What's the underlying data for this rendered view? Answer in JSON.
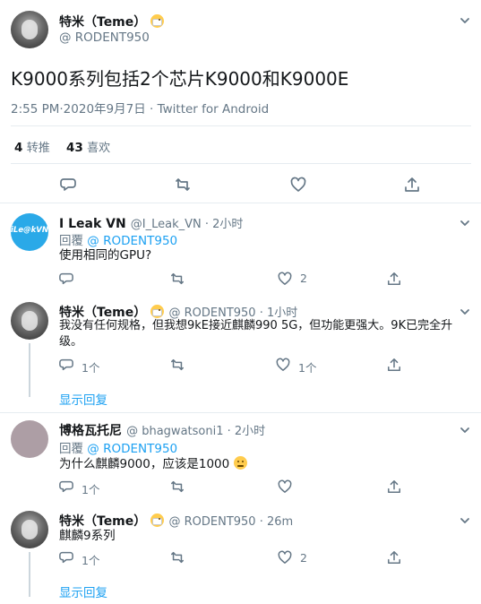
{
  "main_tweet": {
    "author_name": "特米（Teme）",
    "author_handle": "@ RODENT950",
    "text": "K9000系列包括2个芯片K9000和K9000E",
    "timestamp": "2:55 PM·2020年9月7日 · Twitter for Android",
    "retweets_count": "4",
    "retweets_label": "转推",
    "likes_count": "43",
    "likes_label": "喜欢"
  },
  "replies": [
    {
      "author_name": "I Leak VN",
      "author_handle": "@I_Leak_VN · 2小时",
      "reply_prefix": "回覆",
      "reply_to": "@ RODENT950",
      "text": "使用相同的GPU?",
      "avatar_text": "iLe@kVN",
      "reply_count": "",
      "retweet_count": "",
      "like_count": "2"
    },
    {
      "author_name": "特米（Teme）",
      "author_handle": "@ RODENT950 · 1小时",
      "text": "我没有任何规格，但我想9kE接近麒麟990 5G，但功能更强大。9K已完全升级。",
      "reply_count": "1个",
      "retweet_count": "",
      "like_count": "1个",
      "show_replies": "显示回复"
    },
    {
      "author_name": "博格瓦托尼",
      "author_handle": "@ bhagwatsoni1 · 2小时",
      "reply_prefix": "回覆",
      "reply_to": "@ RODENT950",
      "text": "为什么麒麟9000，应该是1000",
      "reply_count": "1个",
      "retweet_count": "",
      "like_count": ""
    },
    {
      "author_name": "特米（Teme）",
      "author_handle": "@ RODENT950 · 26m",
      "text": "麒麟9系列",
      "reply_count": "1个",
      "retweet_count": "",
      "like_count": "2",
      "show_replies": "显示回复"
    }
  ],
  "colors": {
    "link": "#1da1f2",
    "muted": "#657786",
    "separator": "#e6ecf0"
  }
}
